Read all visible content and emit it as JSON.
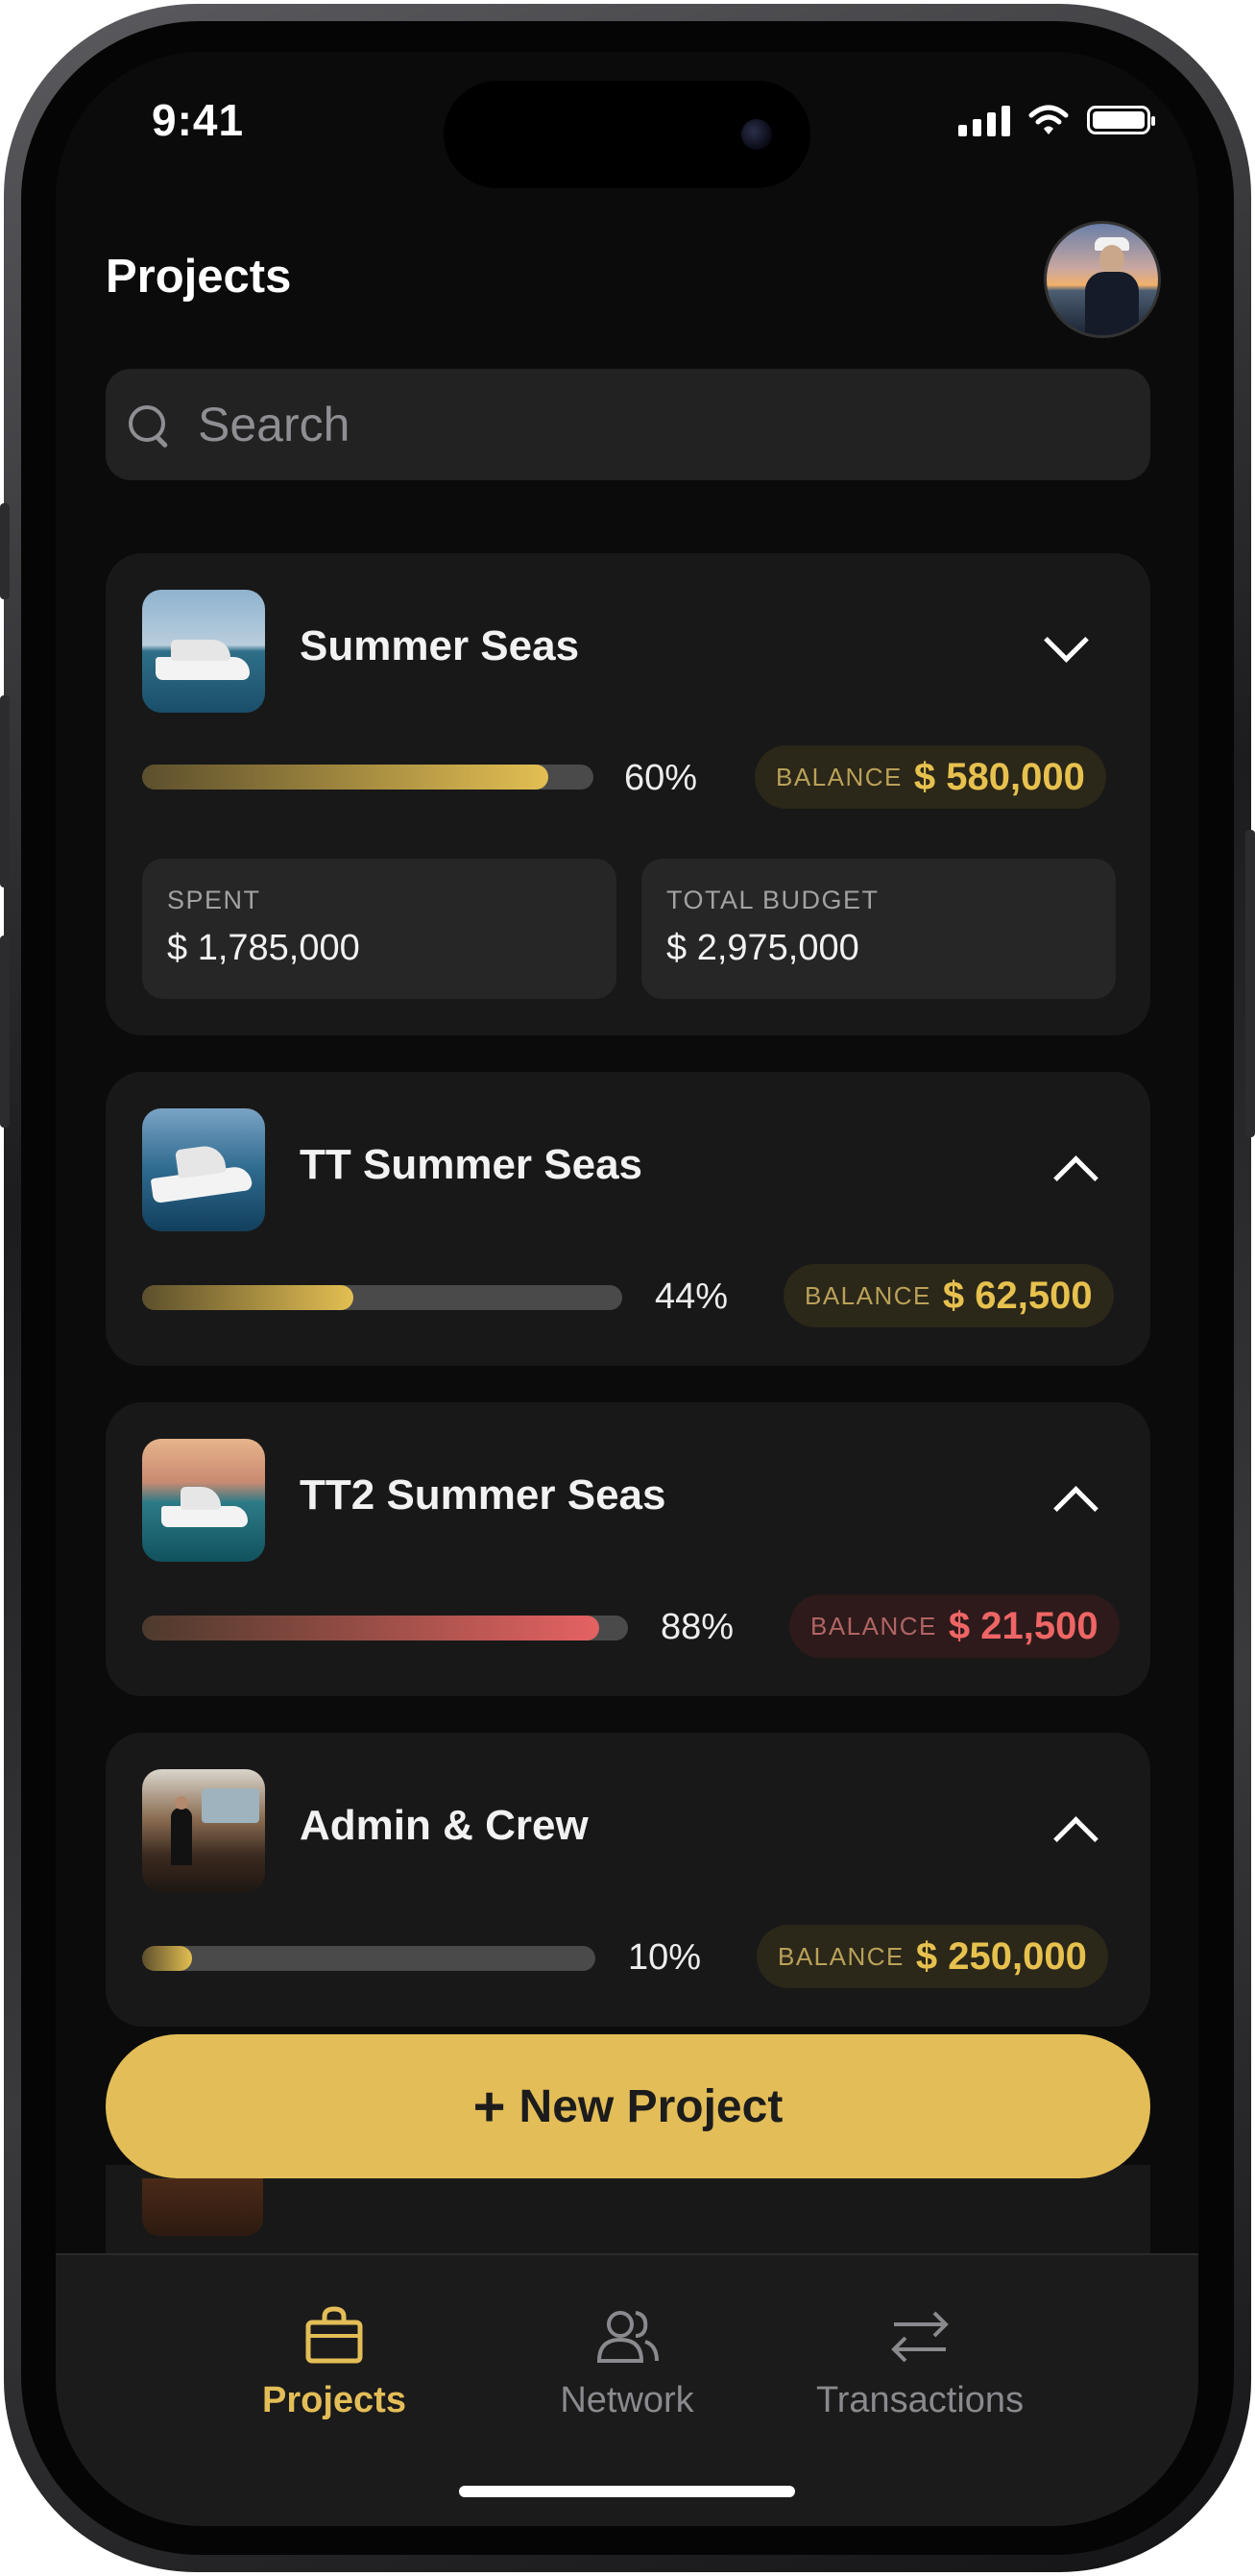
{
  "status_bar": {
    "time": "9:41"
  },
  "header": {
    "title": "Projects"
  },
  "search": {
    "placeholder": "Search"
  },
  "projects": [
    {
      "name": "Summer Seas",
      "expanded": true,
      "progress_label": "60%",
      "progress": 0.9,
      "balance_label": "BALANCE",
      "balance": "$ 580,000",
      "status_color": "#e3bf52",
      "spent_label": "SPENT",
      "spent": "$ 1,785,000",
      "total_budget_label": "TOTAL BUDGET",
      "total_budget": "$ 2,975,000"
    },
    {
      "name": "TT Summer Seas",
      "expanded": false,
      "progress_label": "44%",
      "progress": 0.44,
      "balance_label": "BALANCE",
      "balance": "$ 62,500",
      "status_color": "#e3bf52"
    },
    {
      "name": "TT2 Summer Seas",
      "expanded": false,
      "progress_label": "88%",
      "progress": 0.94,
      "balance_label": "BALANCE",
      "balance": "$ 21,500",
      "status_color": "#ee6565"
    },
    {
      "name": "Admin & Crew",
      "expanded": false,
      "progress_label": "10%",
      "progress": 0.11,
      "balance_label": "BALANCE",
      "balance": "$ 250,000",
      "status_color": "#e3bf52"
    }
  ],
  "new_project_button": {
    "icon": "plus-icon",
    "label": "New Project"
  },
  "tab_bar": {
    "active": "Projects",
    "tabs": [
      {
        "label": "Projects",
        "icon": "shopping-bag-icon"
      },
      {
        "label": "Network",
        "icon": "people-icon"
      },
      {
        "label": "Transactions",
        "icon": "arrows-swap-icon"
      }
    ]
  },
  "colors": {
    "accent": "#e3bd57",
    "danger": "#ee6565",
    "background": "#0b0b0b",
    "card": "#181818"
  }
}
